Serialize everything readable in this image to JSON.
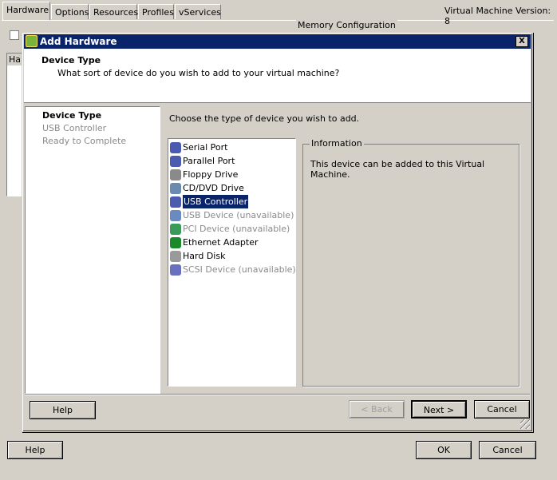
{
  "background": {
    "tabs": [
      "Hardware",
      "Options",
      "Resources",
      "Profiles",
      "vServices"
    ],
    "vm_version": "Virtual Machine Version: 8",
    "memory_group": "Memory Configuration",
    "hardware_col": "Ha",
    "help": "Help",
    "ok": "OK",
    "cancel": "Cancel"
  },
  "dialog": {
    "title": "Add Hardware",
    "header_title": "Device Type",
    "header_subtitle": "What sort of device do you wish to add to your virtual machine?",
    "steps": [
      "Device Type",
      "USB Controller",
      "Ready to Complete"
    ],
    "prompt": "Choose the type of device you wish to add.",
    "devices": [
      {
        "label": "Serial Port",
        "state": "normal",
        "icon": "serial-port-icon",
        "color": "#4a5bb0"
      },
      {
        "label": "Parallel Port",
        "state": "normal",
        "icon": "parallel-port-icon",
        "color": "#4a5bb0"
      },
      {
        "label": "Floppy Drive",
        "state": "normal",
        "icon": "floppy-drive-icon",
        "color": "#8a8a8a"
      },
      {
        "label": "CD/DVD Drive",
        "state": "normal",
        "icon": "cd-dvd-drive-icon",
        "color": "#6a8ab0"
      },
      {
        "label": "USB Controller",
        "state": "selected",
        "icon": "usb-controller-icon",
        "color": "#4a5bb0"
      },
      {
        "label": "USB Device (unavailable)",
        "state": "disabled",
        "icon": "usb-device-icon",
        "color": "#6a8ac0"
      },
      {
        "label": "PCI Device (unavailable)",
        "state": "disabled",
        "icon": "pci-device-icon",
        "color": "#3a9a5a"
      },
      {
        "label": "Ethernet Adapter",
        "state": "normal",
        "icon": "ethernet-adapter-icon",
        "color": "#1a8a2a"
      },
      {
        "label": "Hard Disk",
        "state": "normal",
        "icon": "hard-disk-icon",
        "color": "#9a9a9a"
      },
      {
        "label": "SCSI Device (unavailable)",
        "state": "disabled",
        "icon": "scsi-device-icon",
        "color": "#6a70c0"
      }
    ],
    "info_title": "Information",
    "info_text": "This device can be added to this Virtual Machine.",
    "help": "Help",
    "back": "< Back",
    "next": "Next >",
    "cancel": "Cancel",
    "close": "X"
  }
}
